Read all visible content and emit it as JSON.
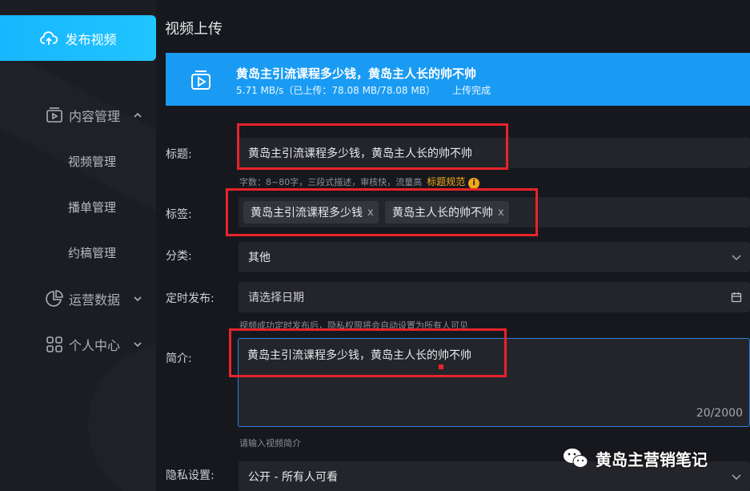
{
  "sidebar": {
    "publish_label": "发布视频",
    "nav": [
      {
        "label": "内容管理",
        "icon": "play-box-icon"
      },
      {
        "label": "视频管理"
      },
      {
        "label": "播单管理"
      },
      {
        "label": "约稿管理"
      },
      {
        "label": "运营数据",
        "icon": "pie-chart-icon"
      },
      {
        "label": "个人中心",
        "icon": "grid-icon"
      }
    ]
  },
  "page": {
    "title": "视频上传"
  },
  "upload": {
    "title": "黄岛主引流课程多少钱，黄岛主人长的帅不帅",
    "progress": "5.71 MB/s（已上传：78.08 MB/78.08 MB）",
    "status": "上传完成"
  },
  "form": {
    "title_label": "标题:",
    "title_value": "黄岛主引流课程多少钱，黄岛主人长的帅不帅",
    "title_hint": "字数：8~80字，三段式描述，审核快，流量高",
    "title_rule_link": "标题规范",
    "tags_label": "标签:",
    "tags": [
      "黄岛主引流课程多少钱",
      "黄岛主人长的帅不帅"
    ],
    "tag_remove": "x",
    "category_label": "分类:",
    "category_value": "其他",
    "schedule_label": "定时发布:",
    "schedule_placeholder": "请选择日期",
    "schedule_hint": "视频成功定时发布后，隐私权限将会自动设置为所有人可见",
    "desc_label": "简介:",
    "desc_value": "黄岛主引流课程多少钱，黄岛主人长的帅不帅",
    "desc_count": "20/2000",
    "desc_hint": "请输入视频简介",
    "privacy_label": "隐私设置:",
    "privacy_value": "公开 - 所有人可看"
  },
  "watermark": {
    "text": "黄岛主营销笔记"
  },
  "colors": {
    "accent": "#1a9bf3",
    "publish": "#17b7ff",
    "highlight": "#e8232b",
    "link": "#f0a818"
  }
}
